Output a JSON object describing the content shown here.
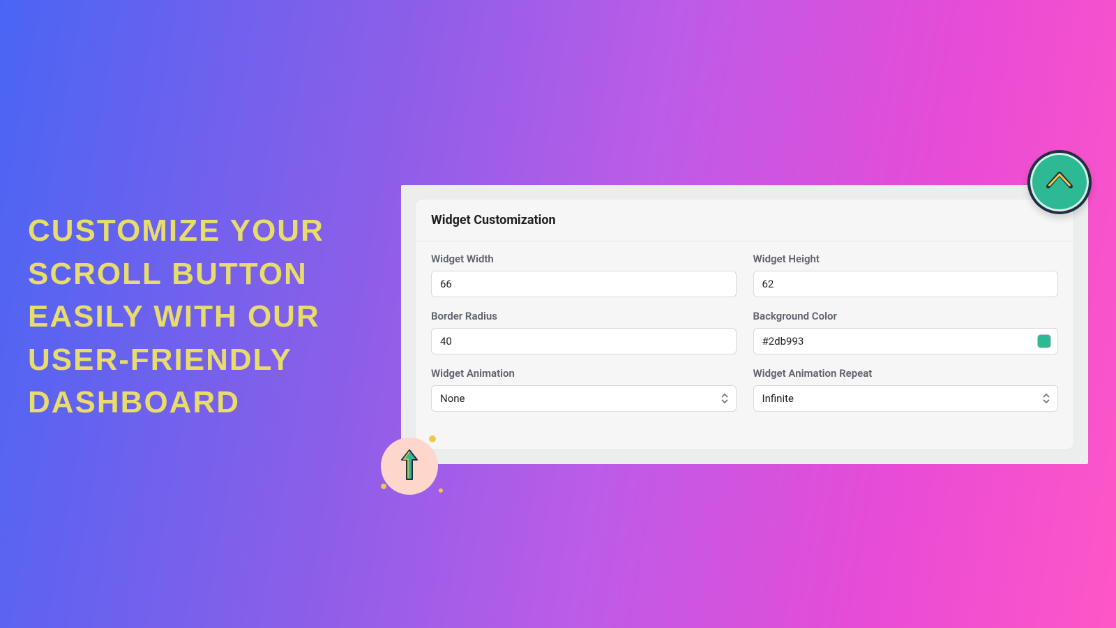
{
  "headline": "CUSTOMIZE YOUR SCROLL BUTTON EASILY WITH OUR USER-FRIENDLY DASHBOARD",
  "panel": {
    "title": "Widget Customization",
    "fields": {
      "width_label": "Widget Width",
      "width_value": "66",
      "height_label": "Widget Height",
      "height_value": "62",
      "radius_label": "Border Radius",
      "radius_value": "40",
      "bgcolor_label": "Background Color",
      "bgcolor_value": "#2db993",
      "bgcolor_swatch": "#2db993",
      "animation_label": "Widget Animation",
      "animation_value": "None",
      "animation_repeat_label": "Widget Animation Repeat",
      "animation_repeat_value": "Infinite"
    }
  },
  "buttons": {
    "top_scroll_bg": "#2db993"
  }
}
